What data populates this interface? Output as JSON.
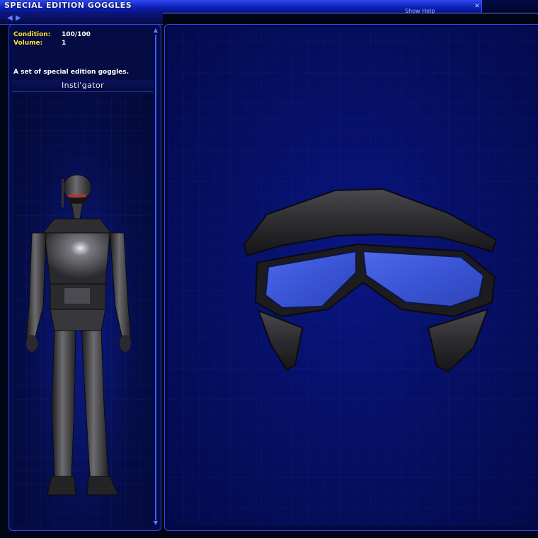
{
  "window": {
    "title": "SPECIAL EDITION GOGGLES",
    "help_label": "Show Help"
  },
  "nav": {
    "back_icon": "arrow-left-icon",
    "forward_icon": "arrow-right-icon"
  },
  "item": {
    "stats": [
      {
        "label": "Condition:",
        "value": "100/100"
      },
      {
        "label": "Volume:",
        "value": "1"
      }
    ],
    "description": "A set of special edition goggles.",
    "owner": "Insti'gator"
  },
  "colors": {
    "accent": "#3146e5",
    "label_yellow": "#ffe02c",
    "lens_blue": "#4e69e8"
  }
}
